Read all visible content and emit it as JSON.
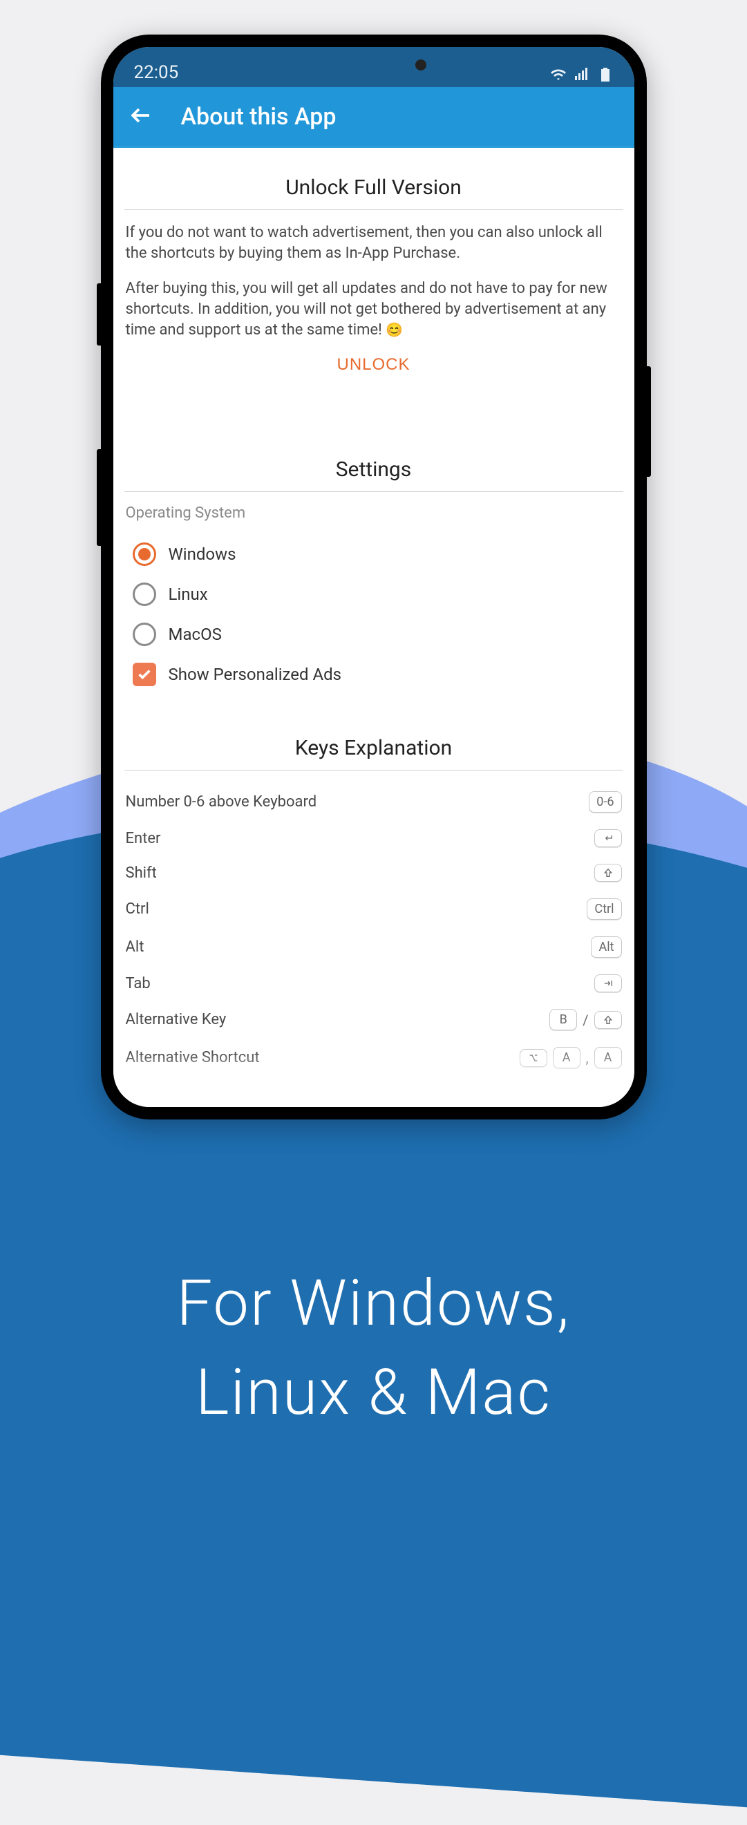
{
  "statusbar": {
    "time": "22:05"
  },
  "appbar": {
    "title": "About this App"
  },
  "unlock": {
    "heading": "Unlock Full Version",
    "para1": "If you do not want to watch advertisement, then you can also unlock all the shortcuts by buying them as In-App Purchase.",
    "para2": "After buying this, you will get all updates and do not have to pay for new shortcuts. In addition, you will not get bothered by advertisement at any time and support us at the same time! ",
    "button": "UNLOCK"
  },
  "settings": {
    "heading": "Settings",
    "os_label": "Operating System",
    "options": {
      "windows": "Windows",
      "linux": "Linux",
      "macos": "MacOS"
    },
    "selected": "windows",
    "ads_label": "Show Personalized Ads",
    "ads_checked": true
  },
  "keys": {
    "heading": "Keys Explanation",
    "rows": {
      "r0": {
        "label": "Number 0-6 above Keyboard",
        "cap": "0-6"
      },
      "r1": {
        "label": "Enter"
      },
      "r2": {
        "label": "Shift"
      },
      "r3": {
        "label": "Ctrl",
        "cap": "Ctrl"
      },
      "r4": {
        "label": "Alt",
        "cap": "Alt"
      },
      "r5": {
        "label": "Tab"
      },
      "r6": {
        "label": "Alternative Key",
        "capA": "B",
        "sep": "/"
      },
      "r7": {
        "label": "Alternative Shortcut",
        "capA": "A",
        "sep": ",",
        "capB": "A"
      }
    }
  },
  "promo": {
    "line1": "For Windows,",
    "line2": "Linux & Mac"
  }
}
